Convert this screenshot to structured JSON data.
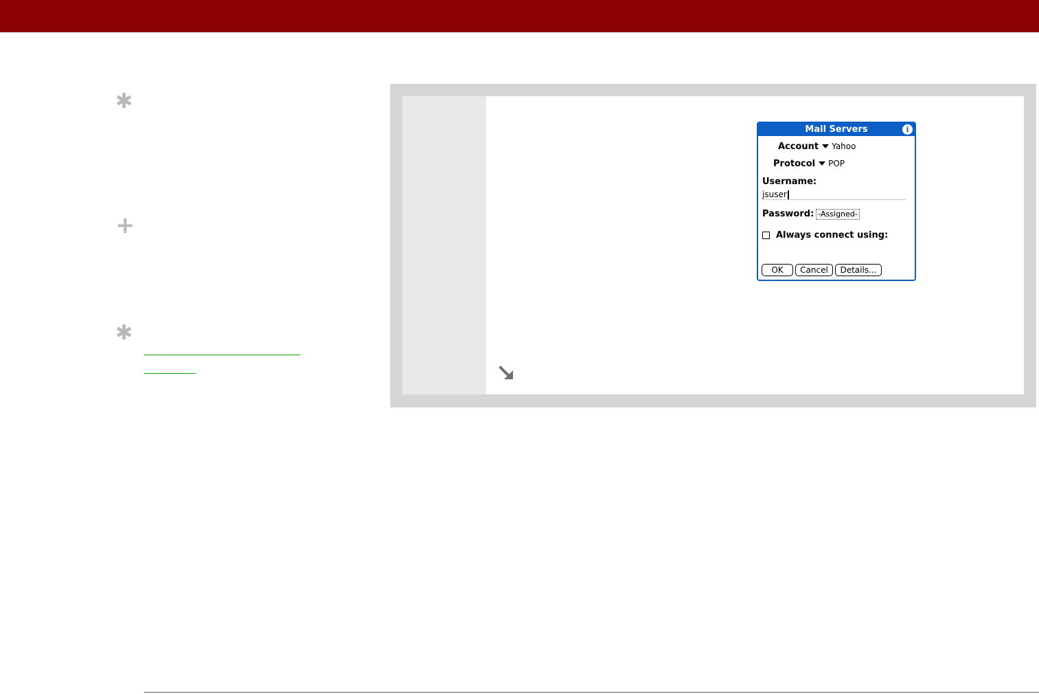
{
  "dialog": {
    "title": "Mail Servers",
    "info_icon": "i",
    "account_label": "Account",
    "account_value": "Yahoo",
    "protocol_label": "Protocol",
    "protocol_value": "POP",
    "username_label": "Username:",
    "username_value": "jsuser",
    "password_label": "Password:",
    "password_value": "-Assigned-",
    "always_connect_label": "Always connect using:",
    "buttons": {
      "ok": "OK",
      "cancel": "Cancel",
      "details": "Details..."
    }
  },
  "sidebar": {
    "tip_icon": "✱",
    "plus_icon": "+"
  },
  "colors": {
    "header": "#8b0000",
    "dialog_blue": "#0b5fc5",
    "link_green": "#00a000"
  }
}
